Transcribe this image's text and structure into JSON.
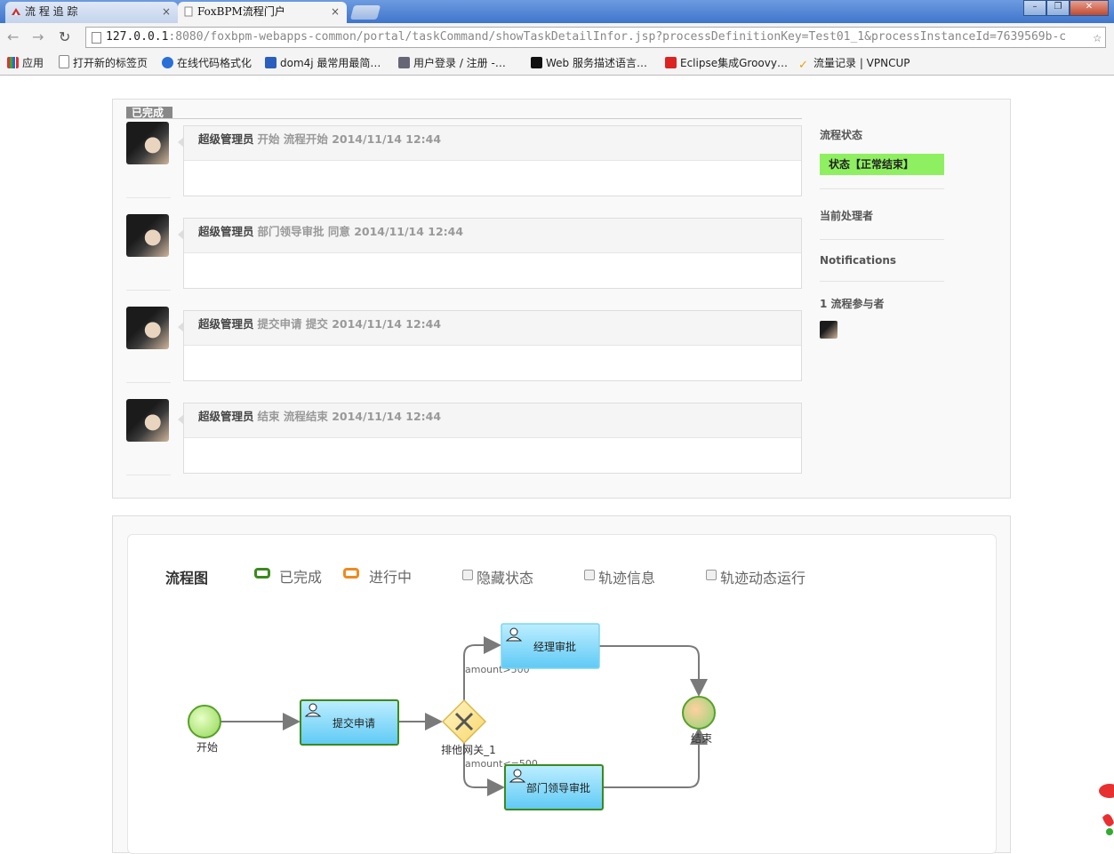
{
  "browser": {
    "tabs": [
      {
        "label": "流 程 追 踪",
        "close": "×"
      },
      {
        "label": "FoxBPM流程门户",
        "close": "×"
      }
    ],
    "address": {
      "host": "127.0.0.1",
      "rest": ":8080/foxbpm-webapps-common/portal/taskCommand/showTaskDetailInfor.jsp?processDefinitionKey=Test01_1&processInstanceId=7639569b-c"
    },
    "bookmarks": [
      "应用",
      "打开新的标签页",
      "在线代码格式化",
      "dom4j 最常用最简…",
      "用户登录 / 注册 -…",
      "Web 服务描述语言…",
      "Eclipse集成Groovy…",
      "流量记录 | VPNCUP"
    ]
  },
  "history": {
    "section_tag": "已完成",
    "entries": [
      {
        "user": "超级管理员",
        "detail": "开始 流程开始 2014/11/14 12:44"
      },
      {
        "user": "超级管理员",
        "detail": "部门领导审批 同意 2014/11/14 12:44"
      },
      {
        "user": "超级管理员",
        "detail": "提交申请 提交 2014/11/14 12:44"
      },
      {
        "user": "超级管理员",
        "detail": "结束 流程结束 2014/11/14 12:44"
      }
    ]
  },
  "sidebar": {
    "status_label": "流程状态",
    "status_value": "状态【正常结束】",
    "handler_label": "当前处理者",
    "notifications_label": "Notifications",
    "participants_label": "1 流程参与者",
    "status_color": "#8ef060"
  },
  "diagram": {
    "title": "流程图",
    "legend": [
      {
        "label": "已完成",
        "color": "#3a8a1c"
      },
      {
        "label": "进行中",
        "color": "#f08a1c"
      }
    ],
    "options": [
      "隐藏状态",
      "轨迹信息",
      "轨迹动态运行"
    ],
    "nodes": {
      "start": "开始",
      "submit": "提交申请",
      "gateway": "排他网关_1",
      "manager": "经理审批",
      "dept": "部门领导审批",
      "end": "结束"
    },
    "conditions": {
      "high": "amount>500",
      "low": "amount<=500"
    }
  }
}
